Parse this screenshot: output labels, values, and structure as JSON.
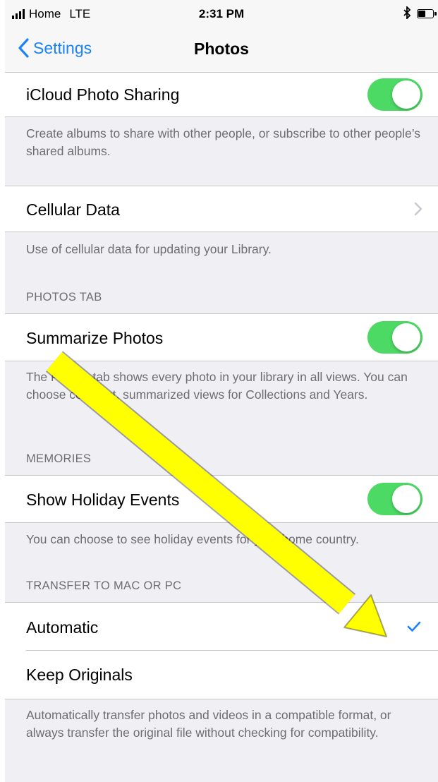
{
  "status_bar": {
    "carrier": "Home",
    "network": "LTE",
    "time": "2:31 PM"
  },
  "nav": {
    "back_label": "Settings",
    "title": "Photos"
  },
  "icloud": {
    "label": "iCloud Photo Sharing",
    "on": true,
    "footer": "Create albums to share with other people, or subscribe to other people’s shared albums."
  },
  "cellular": {
    "label": "Cellular Data",
    "footer": "Use of cellular data for updating your Library."
  },
  "photos_tab": {
    "header": "PHOTOS TAB",
    "label": "Summarize Photos",
    "on": true,
    "footer": "The Photos tab shows every photo in your library in all views. You can choose compact, summarized views for Collections and Years."
  },
  "memories": {
    "header": "MEMORIES",
    "label": "Show Holiday Events",
    "on": true,
    "footer": "You can choose to see holiday events for your home country."
  },
  "transfer": {
    "header": "TRANSFER TO MAC OR PC",
    "options": [
      "Automatic",
      "Keep Originals"
    ],
    "selected": "Automatic",
    "footer": "Automatically transfer photos and videos in a compatible format, or always transfer the original file without checking for compatibility."
  },
  "colors": {
    "accent": "#1a82fb",
    "toggle_on": "#4cd964",
    "annotation_arrow": "#ffff00"
  }
}
